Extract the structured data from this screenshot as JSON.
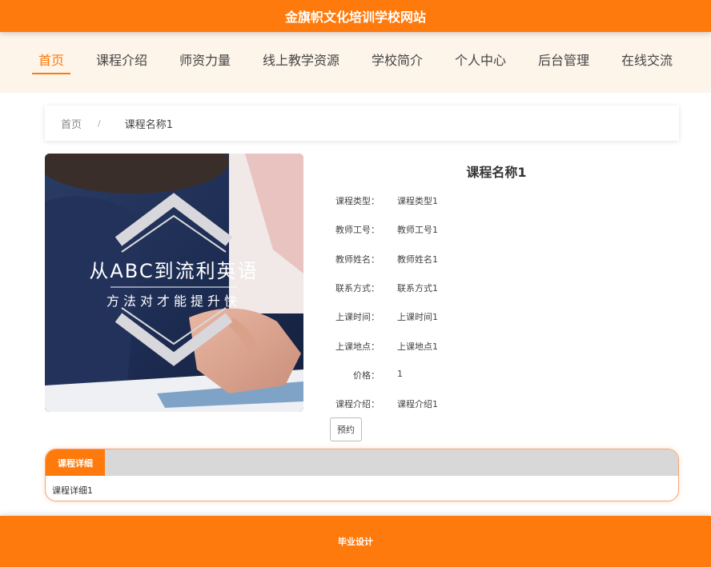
{
  "site": {
    "title": "金旗帜文化培训学校网站"
  },
  "nav": {
    "items": [
      {
        "label": "首页",
        "active": true
      },
      {
        "label": "课程介绍"
      },
      {
        "label": "师资力量"
      },
      {
        "label": "线上教学资源"
      },
      {
        "label": "学校简介"
      },
      {
        "label": "个人中心"
      },
      {
        "label": "后台管理"
      },
      {
        "label": "在线交流"
      }
    ]
  },
  "breadcrumb": {
    "home": "首页",
    "separator": "/",
    "current": "课程名称1"
  },
  "course": {
    "image": {
      "headline": "从ABC到流利英语",
      "tagline": "方法对才能提升快"
    },
    "title": "课程名称1",
    "fields": [
      {
        "label": "课程类型：",
        "value": "课程类型1"
      },
      {
        "label": "教师工号：",
        "value": "教师工号1"
      },
      {
        "label": "教师姓名：",
        "value": "教师姓名1"
      },
      {
        "label": "联系方式：",
        "value": "联系方式1"
      },
      {
        "label": "上课时间：",
        "value": "上课时间1"
      },
      {
        "label": "上课地点：",
        "value": "上课地点1"
      },
      {
        "label": "价格：",
        "value": "1"
      },
      {
        "label": "课程介绍：",
        "value": "课程介绍1"
      }
    ],
    "book_button": "预约"
  },
  "details": {
    "tab_label": "课程详细",
    "content": "课程详细1"
  },
  "footer": {
    "text": "毕业设计"
  },
  "colors": {
    "accent": "#ff7a0c",
    "nav_bg": "#fdf4ea",
    "tab_bar": "#d8d8d8"
  }
}
